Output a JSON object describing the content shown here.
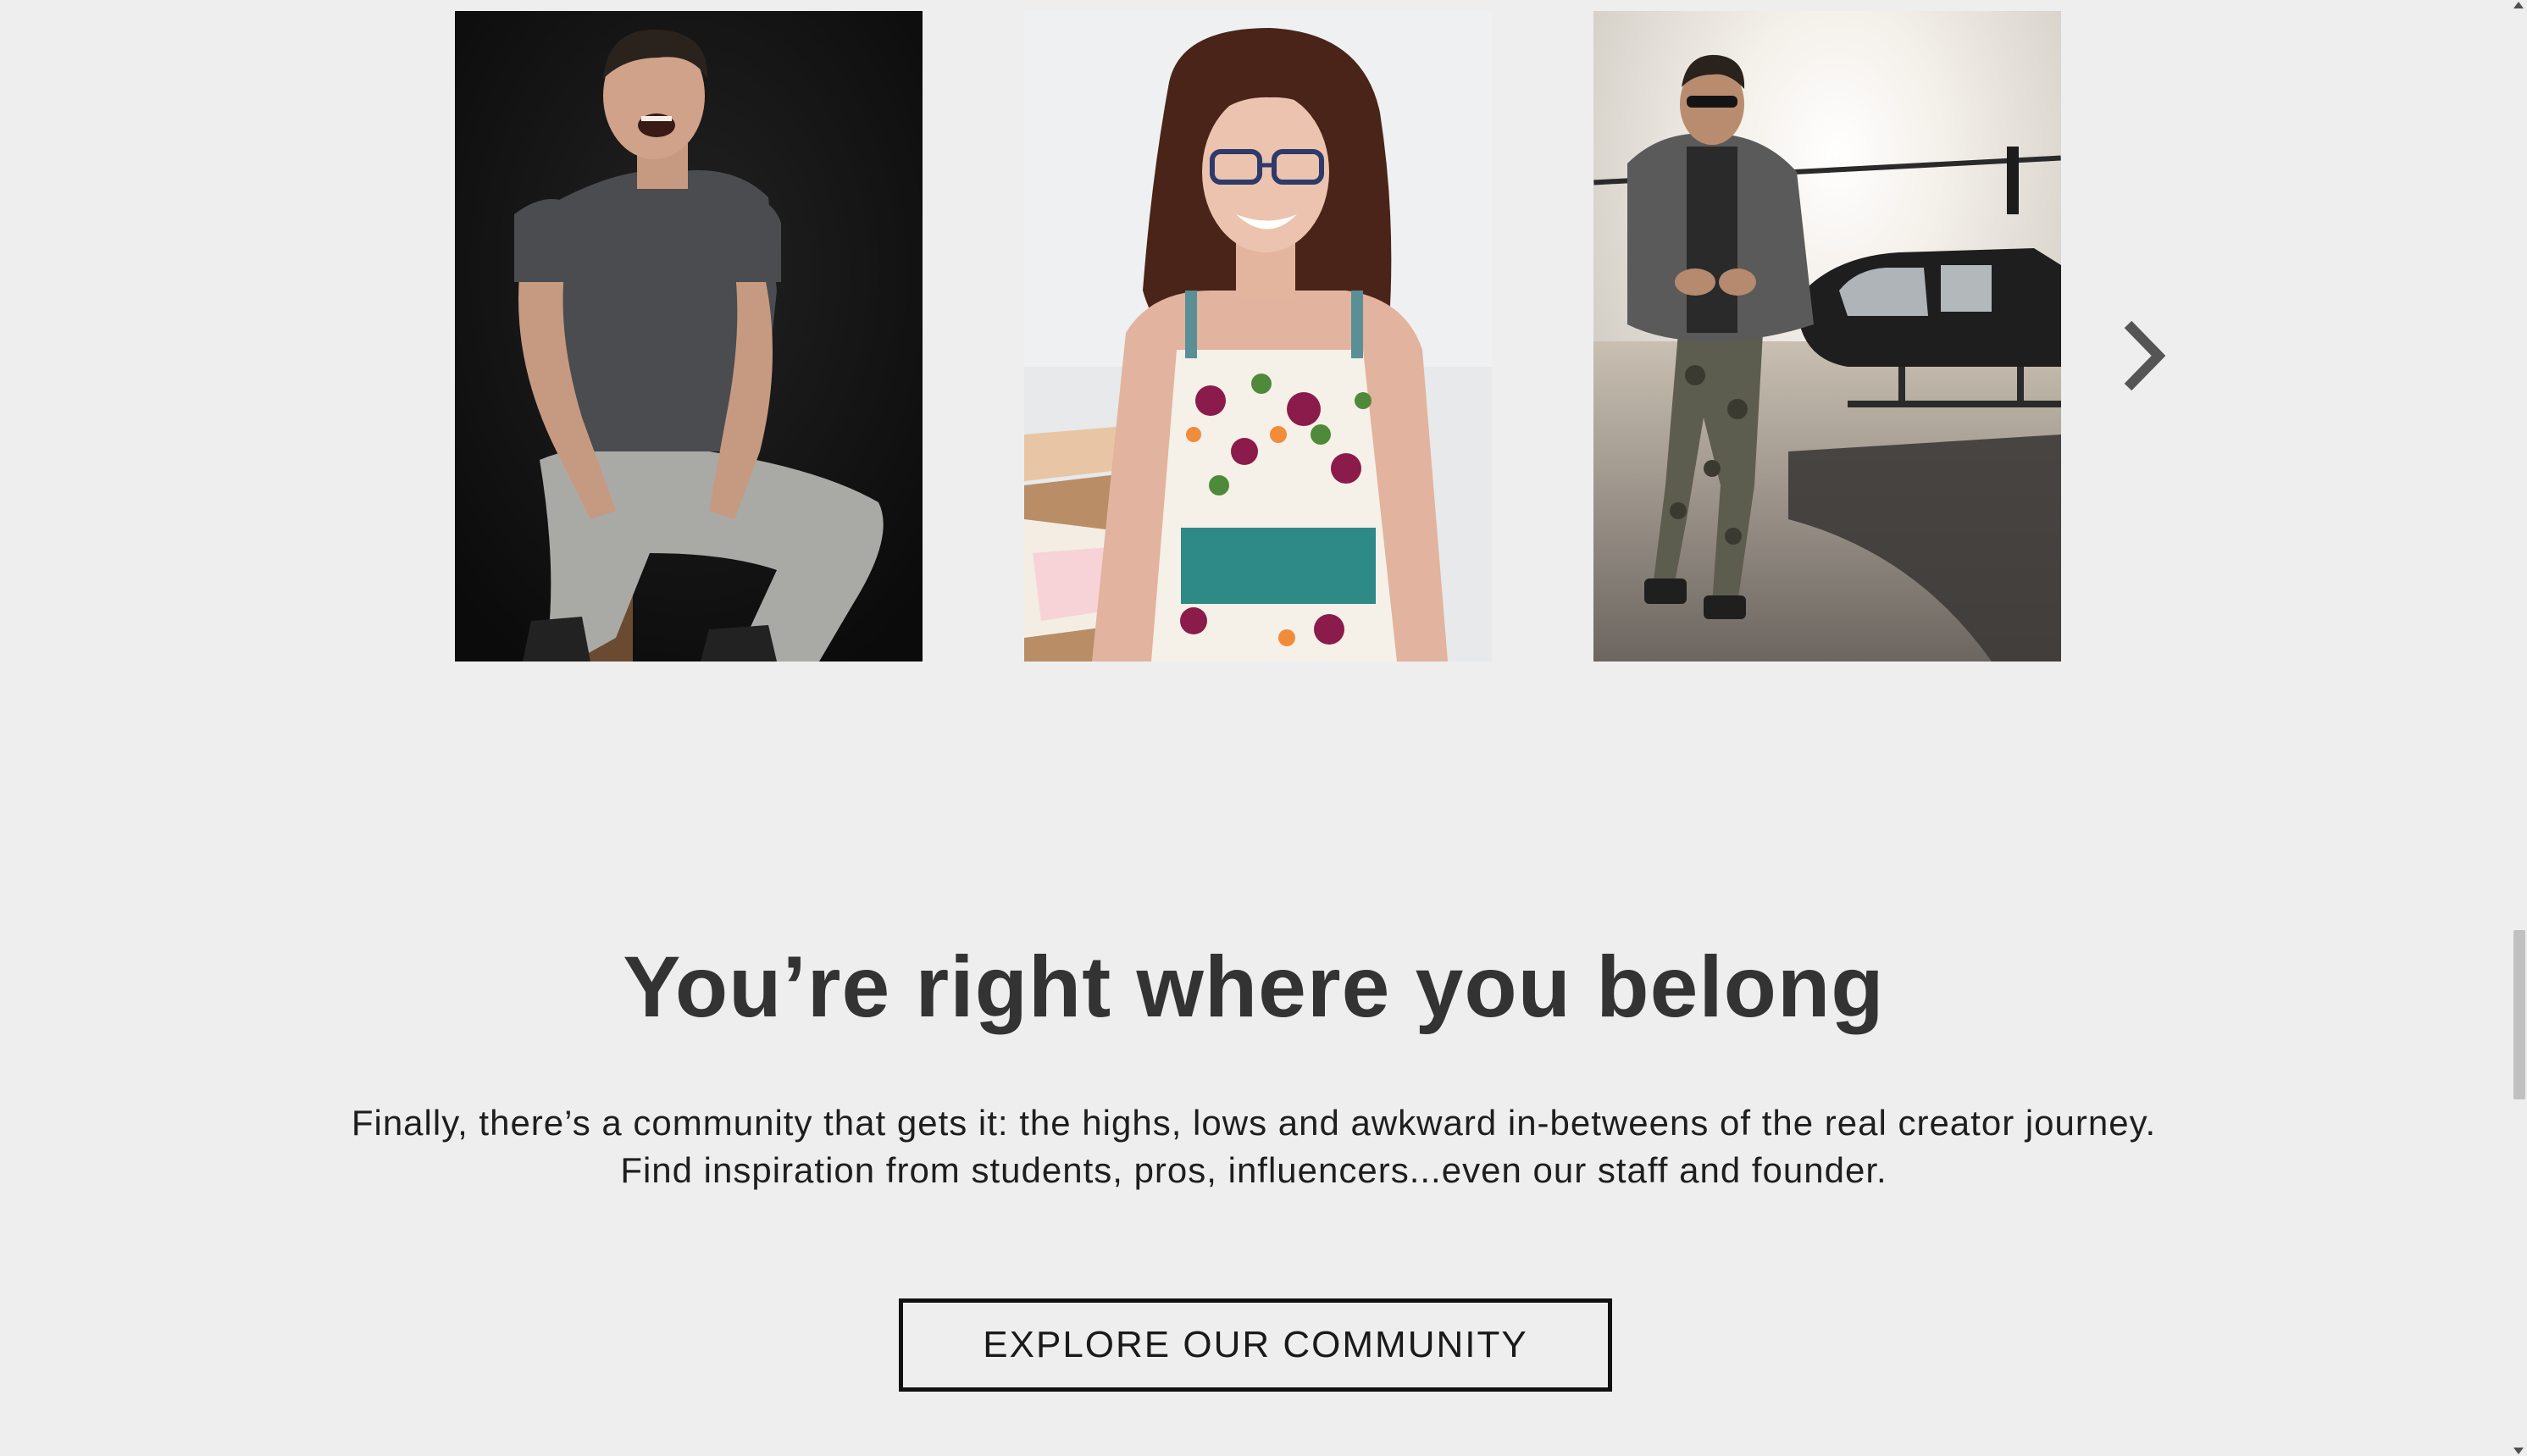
{
  "carousel": {
    "photos": [
      {
        "subject": "man-laughing-on-stool-photo"
      },
      {
        "subject": "woman-with-glasses-smiling-photo"
      },
      {
        "subject": "man-walking-by-helicopter-photo"
      }
    ],
    "next_icon": "chevron-right-icon"
  },
  "community": {
    "headline": "You’re right where you belong",
    "body": "Finally, there’s a community that gets it: the highs, lows and awkward in-betweens of the real creator journey. Find inspiration from students, pros, influencers...even our staff and founder.",
    "cta_label": "EXPLORE OUR COMMUNITY"
  },
  "colors": {
    "background": "#eeeeee",
    "headline": "#333333",
    "body_text": "#1e1e1e",
    "button_border": "#111111",
    "chevron": "#555555"
  }
}
